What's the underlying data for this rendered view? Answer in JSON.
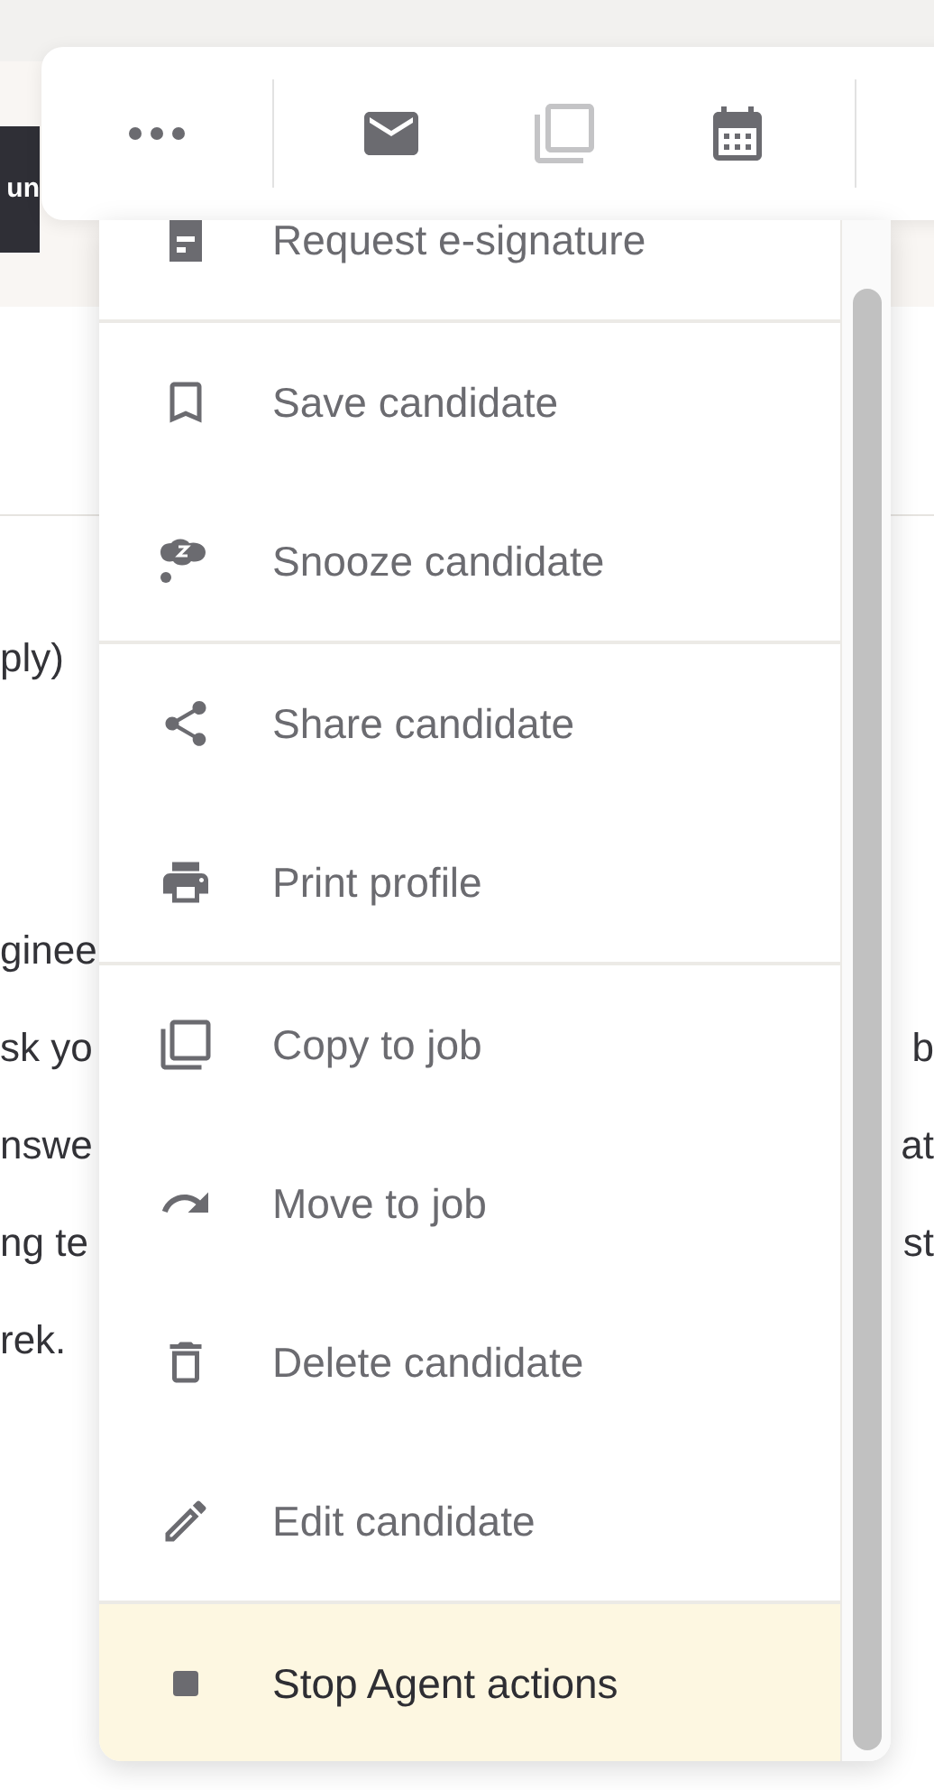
{
  "background": {
    "button_fragment": "un",
    "rows": [
      {
        "left": "ply)"
      },
      {},
      {},
      {
        "left": "ginee"
      },
      {
        "left": "sk yo",
        "right": "b"
      },
      {
        "left": "nswe",
        "right": "at"
      },
      {
        "left": "ng te",
        "right": "st"
      },
      {
        "left": "rek."
      }
    ]
  },
  "toolbar": {
    "buttons": [
      {
        "kind": "more",
        "disabled": false
      },
      {
        "kind": "mail",
        "disabled": false
      },
      {
        "kind": "copy",
        "disabled": true
      },
      {
        "kind": "calendar",
        "disabled": false
      }
    ]
  },
  "menu": {
    "groups": [
      {
        "items": [
          {
            "label": "Request e-signature",
            "highlighted": false
          }
        ]
      },
      {
        "items": [
          {
            "label": "Save candidate",
            "highlighted": false
          },
          {
            "label": "Snooze candidate",
            "highlighted": false
          }
        ]
      },
      {
        "items": [
          {
            "label": "Share candidate",
            "highlighted": false
          },
          {
            "label": "Print profile",
            "highlighted": false
          }
        ]
      },
      {
        "items": [
          {
            "label": "Copy to job",
            "highlighted": false
          },
          {
            "label": "Move to job",
            "highlighted": false
          },
          {
            "label": "Delete candidate",
            "highlighted": false
          },
          {
            "label": "Edit candidate",
            "highlighted": false
          }
        ]
      },
      {
        "items": [
          {
            "label": "Stop Agent actions",
            "highlighted": true
          }
        ]
      }
    ]
  }
}
